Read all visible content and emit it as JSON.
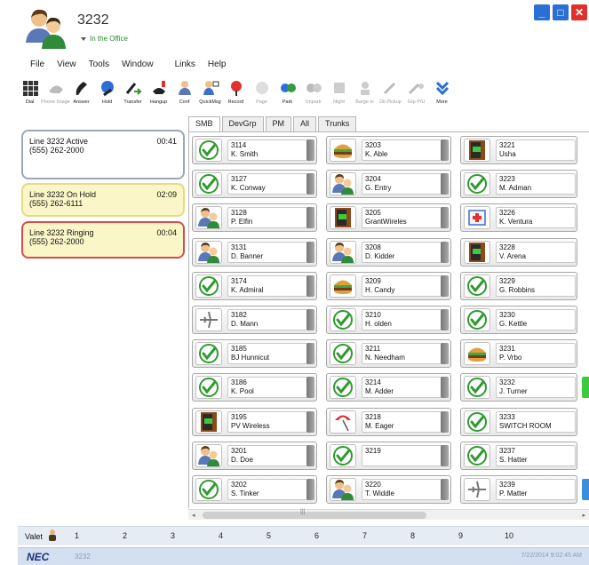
{
  "header": {
    "extension": "3232",
    "presence": "In the Office"
  },
  "window_controls": {
    "minimize": "_",
    "maximize": "□",
    "close": "✕"
  },
  "menu": [
    "File",
    "View",
    "Tools",
    "Window",
    "Links",
    "Help"
  ],
  "toolbar": [
    {
      "label": "Dial",
      "icon": "dialpad-icon",
      "enabled": true
    },
    {
      "label": "Phone Image",
      "icon": "phone-image-icon",
      "enabled": false
    },
    {
      "label": "Answer",
      "icon": "answer-icon",
      "enabled": true
    },
    {
      "label": "Hold",
      "icon": "hold-icon",
      "enabled": true
    },
    {
      "label": "Transfer",
      "icon": "transfer-icon",
      "enabled": true
    },
    {
      "label": "Hangup",
      "icon": "hangup-icon",
      "enabled": true
    },
    {
      "label": "Conf",
      "icon": "conference-icon",
      "enabled": true
    },
    {
      "label": "QuickMsg",
      "icon": "quick-message-icon",
      "enabled": true
    },
    {
      "label": "Record",
      "icon": "record-icon",
      "enabled": true
    },
    {
      "label": "Page",
      "icon": "page-icon",
      "enabled": false
    },
    {
      "label": "Park",
      "icon": "park-icon",
      "enabled": true
    },
    {
      "label": "Unpark",
      "icon": "unpark-icon",
      "enabled": false
    },
    {
      "label": "Night",
      "icon": "night-icon",
      "enabled": false
    },
    {
      "label": "Barge in",
      "icon": "barge-in-icon",
      "enabled": false
    },
    {
      "label": "Dir.Pickup",
      "icon": "directed-pickup-icon",
      "enabled": false
    },
    {
      "label": "Grp P/U",
      "icon": "group-pickup-icon",
      "enabled": false
    },
    {
      "label": "More",
      "icon": "more-icon",
      "enabled": true
    }
  ],
  "calls": [
    {
      "title": "Line 3232 Active",
      "number": "(555) 262-2000",
      "time": "00:41",
      "state": "active"
    },
    {
      "title": "Line 3232 On Hold",
      "number": "(555) 262-6111",
      "time": "02:09",
      "state": "hold"
    },
    {
      "title": "Line 3232 Ringing",
      "number": "(555) 262-2000",
      "time": "00:04",
      "state": "ringing"
    }
  ],
  "tabs": [
    "SMB",
    "DevGrp",
    "PM",
    "All",
    "Trunks"
  ],
  "active_tab": "SMB",
  "directory": [
    [
      {
        "ext": "3114",
        "name": "K. Smith",
        "status": "available"
      },
      {
        "ext": "3127",
        "name": "K. Conway",
        "status": "available"
      },
      {
        "ext": "3128",
        "name": "P. Elfin",
        "status": "meeting"
      },
      {
        "ext": "3131",
        "name": "D. Banner",
        "status": "meeting"
      },
      {
        "ext": "3174",
        "name": "K. Admiral",
        "status": "available"
      },
      {
        "ext": "3182",
        "name": "D. Mann",
        "status": "travel"
      },
      {
        "ext": "3185",
        "name": "BJ Hunnicut",
        "status": "available"
      },
      {
        "ext": "3186",
        "name": "K. Pool",
        "status": "available"
      },
      {
        "ext": "3195",
        "name": "PV Wireless",
        "status": "out"
      },
      {
        "ext": "3201",
        "name": "D. Doe",
        "status": "meeting"
      },
      {
        "ext": "3202",
        "name": "S. Tinker",
        "status": "available"
      }
    ],
    [
      {
        "ext": "3203",
        "name": "K. Able",
        "status": "lunch"
      },
      {
        "ext": "3204",
        "name": "G. Entry",
        "status": "meeting"
      },
      {
        "ext": "3205",
        "name": "GrantWireles",
        "status": "out"
      },
      {
        "ext": "3208",
        "name": "D. Kidder",
        "status": "meeting"
      },
      {
        "ext": "3209",
        "name": "H. Candy",
        "status": "lunch"
      },
      {
        "ext": "3210",
        "name": "H. olden",
        "status": "available"
      },
      {
        "ext": "3211",
        "name": "N. Needham",
        "status": "available"
      },
      {
        "ext": "3214",
        "name": "M. Adder",
        "status": "available"
      },
      {
        "ext": "3218",
        "name": "M. Eager",
        "status": "vacation"
      },
      {
        "ext": "3219",
        "name": "",
        "status": "available"
      },
      {
        "ext": "3220",
        "name": "T. Widdle",
        "status": "meeting"
      }
    ],
    [
      {
        "ext": "3221",
        "name": "Usha",
        "status": "out"
      },
      {
        "ext": "3223",
        "name": "M. Adman",
        "status": "available"
      },
      {
        "ext": "3226",
        "name": "K. Ventura",
        "status": "sick"
      },
      {
        "ext": "3228",
        "name": "V. Arena",
        "status": "out"
      },
      {
        "ext": "3229",
        "name": "G. Robbins",
        "status": "available"
      },
      {
        "ext": "3230",
        "name": "G. Kettle",
        "status": "available"
      },
      {
        "ext": "3231",
        "name": "P. Vrbo",
        "status": "lunch"
      },
      {
        "ext": "3232",
        "name": "J. Turner",
        "status": "available"
      },
      {
        "ext": "3233",
        "name": "SWITCH ROOM",
        "status": "available"
      },
      {
        "ext": "3237",
        "name": "S. Hatter",
        "status": "available"
      },
      {
        "ext": "3239",
        "name": "P. Matter",
        "status": "travel"
      }
    ]
  ],
  "col3_edge_colors": {
    "7": "#3ccb3c",
    "10": "#3a8de0"
  },
  "scroll_grip": "|||",
  "scroll_left": "◂",
  "scroll_right": "▸",
  "valet": {
    "label": "Valet",
    "slots": [
      "1",
      "2",
      "3",
      "4",
      "5",
      "6",
      "7",
      "8",
      "9",
      "10"
    ]
  },
  "status_bar": {
    "brand": "NEC",
    "extension": "3232",
    "datetime": "7/22/2014 9:02:45 AM"
  },
  "colors": {
    "accent": "#2b6fd6",
    "close": "#e0302c",
    "available": "#2f9a2f",
    "hold_bg": "#fbf6c8",
    "ringing_border": "#dd4a4a"
  }
}
